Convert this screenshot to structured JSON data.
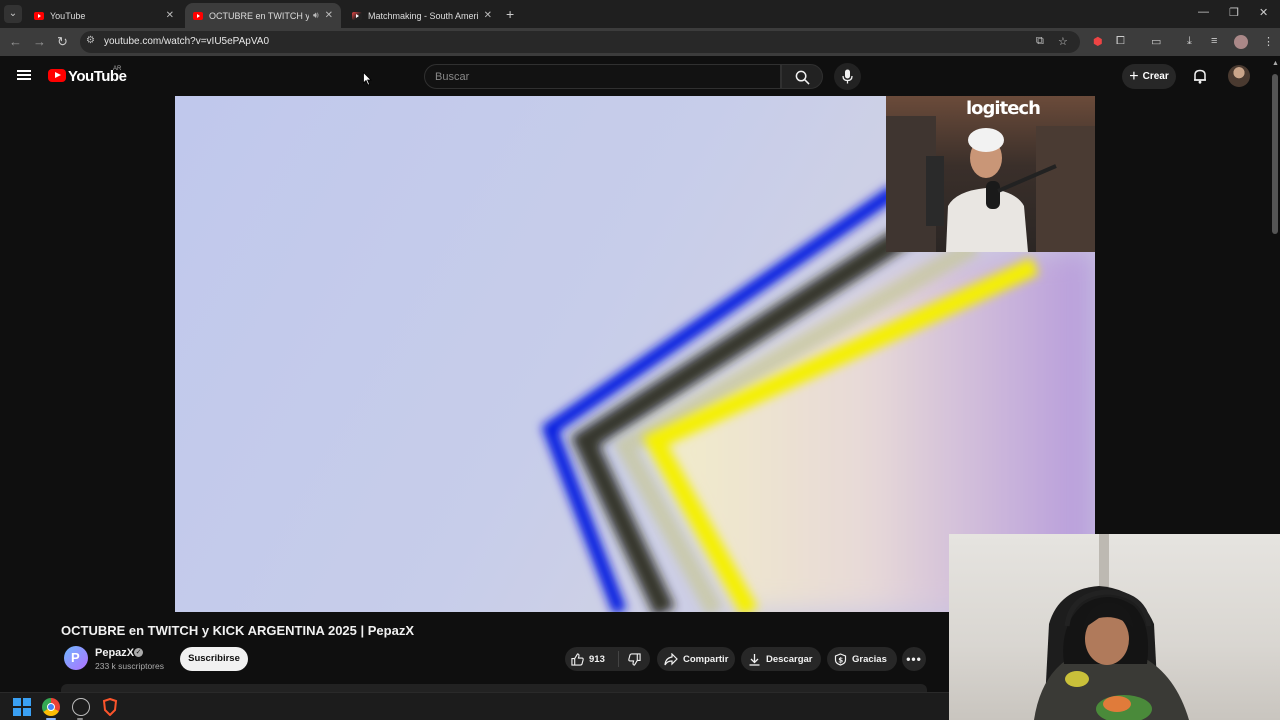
{
  "browser": {
    "tabs": [
      {
        "title": "YouTube",
        "active": false
      },
      {
        "title": "OCTUBRE en TWITCH y KIC",
        "active": true
      },
      {
        "title": "Matchmaking - South America",
        "active": false
      }
    ],
    "url": "youtube.com/watch?v=vIU5ePApVA0"
  },
  "youtube": {
    "logo_text": "YouTube",
    "country_code": "AR",
    "search_placeholder": "Buscar",
    "create_label": "Crear"
  },
  "video": {
    "overlay_banner": "logitech",
    "title": "OCTUBRE en TWITCH y KICK ARGENTINA 2025 | PepazX",
    "channel_name": "PepazX",
    "subscribers": "233 k suscriptores",
    "subscribe_label": "Suscribirse",
    "likes": "913",
    "share_label": "Compartir",
    "download_label": "Descargar",
    "thanks_label": "Gracias",
    "more_label": "•••"
  },
  "colors": {
    "yt_red": "#ff0000",
    "background": "#0f0f0f",
    "pill": "#272727"
  }
}
